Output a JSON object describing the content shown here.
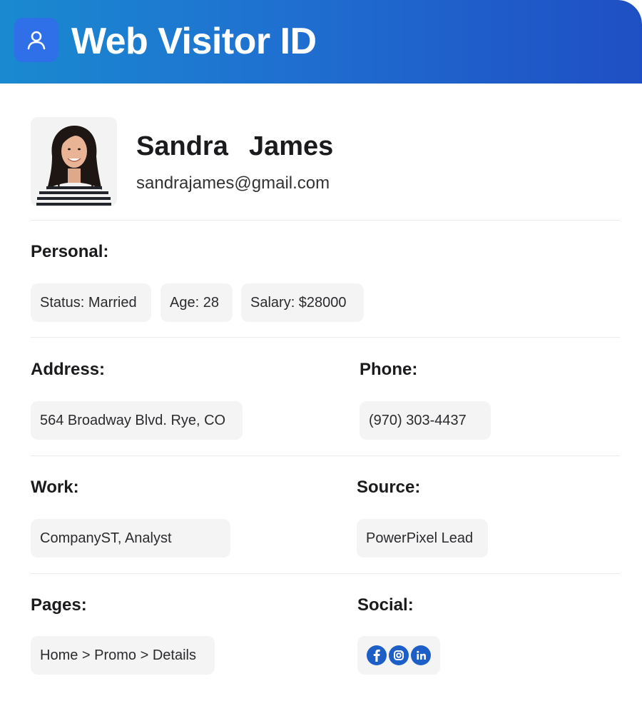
{
  "header": {
    "title": "Web Visitor ID",
    "icon": "user-icon"
  },
  "profile": {
    "name": "Sandra  James",
    "email": "sandrajames@gmail.com"
  },
  "sections": {
    "personal": {
      "label": "Personal:",
      "chips": [
        "Status: Married",
        "Age: 28",
        "Salary: $28000"
      ]
    },
    "address": {
      "label": "Address:",
      "value": "564 Broadway Blvd. Rye, CO"
    },
    "phone": {
      "label": "Phone:",
      "value": "(970) 303-4437"
    },
    "work": {
      "label": "Work:",
      "value": "CompanyST, Analyst"
    },
    "source": {
      "label": "Source:",
      "value": "PowerPixel Lead"
    },
    "pages": {
      "label": "Pages:",
      "value": "Home > Promo > Details"
    },
    "social": {
      "label": "Social:",
      "icons": [
        "facebook-icon",
        "instagram-icon",
        "linkedin-icon"
      ]
    }
  },
  "colors": {
    "header_start": "#1a8ad0",
    "header_end": "#1f4fc4",
    "social_blue": "#1c5fc7",
    "chip_bg": "#f4f4f5"
  }
}
